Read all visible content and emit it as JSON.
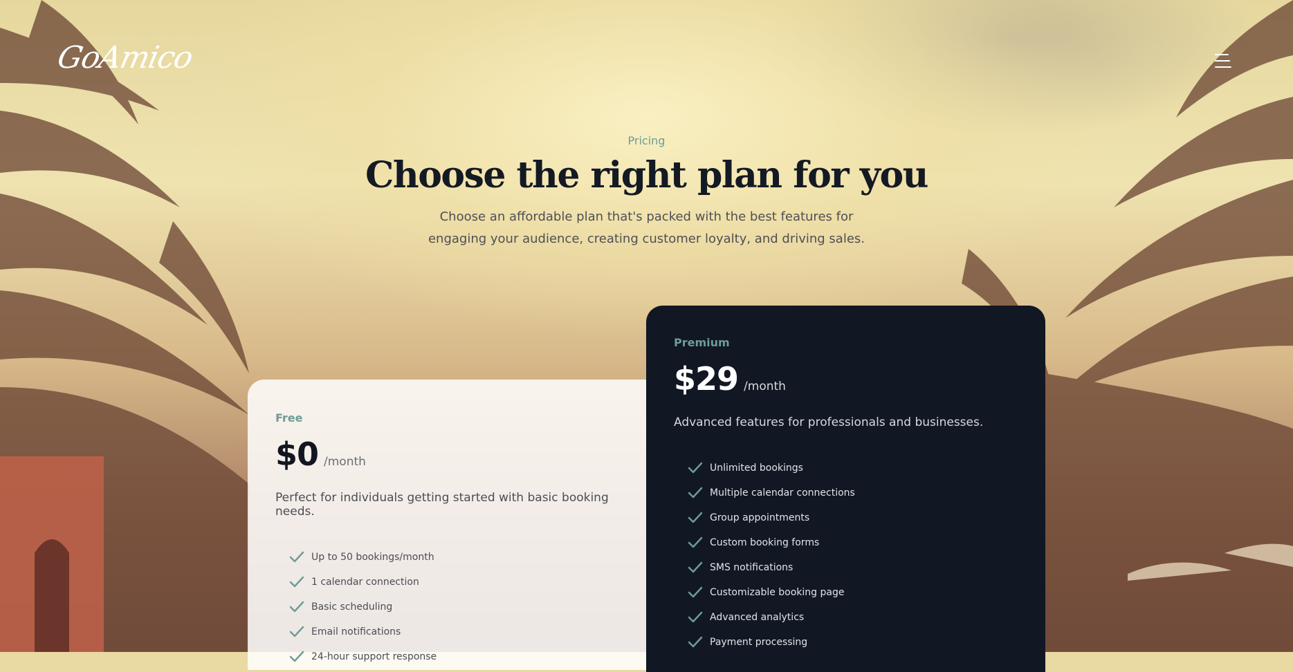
{
  "brand": {
    "logo_text": "GoAmico"
  },
  "header": {
    "menu_icon": "hamburger-menu-icon"
  },
  "hero": {
    "eyebrow": "Pricing",
    "title": "Choose the right plan for you",
    "subtitle": "Choose an affordable plan that's packed with the best features for engaging your audience, creating customer loyalty, and driving sales."
  },
  "plans": [
    {
      "name": "Free",
      "price": "$0",
      "period": "/month",
      "description": "Perfect for individuals getting started with basic booking needs.",
      "features": [
        "Up to 50 bookings/month",
        "1 calendar connection",
        "Basic scheduling",
        "Email notifications",
        "24-hour support response"
      ]
    },
    {
      "name": "Premium",
      "price": "$29",
      "period": "/month",
      "description": "Advanced features for professionals and businesses.",
      "features": [
        "Unlimited bookings",
        "Multiple calendar connections",
        "Group appointments",
        "Custom booking forms",
        "SMS notifications",
        "Customizable booking page",
        "Advanced analytics",
        "Payment processing"
      ]
    }
  ],
  "colors": {
    "accent": "#6e9c98",
    "dark_card": "#111723",
    "title": "#141a24"
  },
  "icons": {
    "feature_check": "check-icon"
  }
}
